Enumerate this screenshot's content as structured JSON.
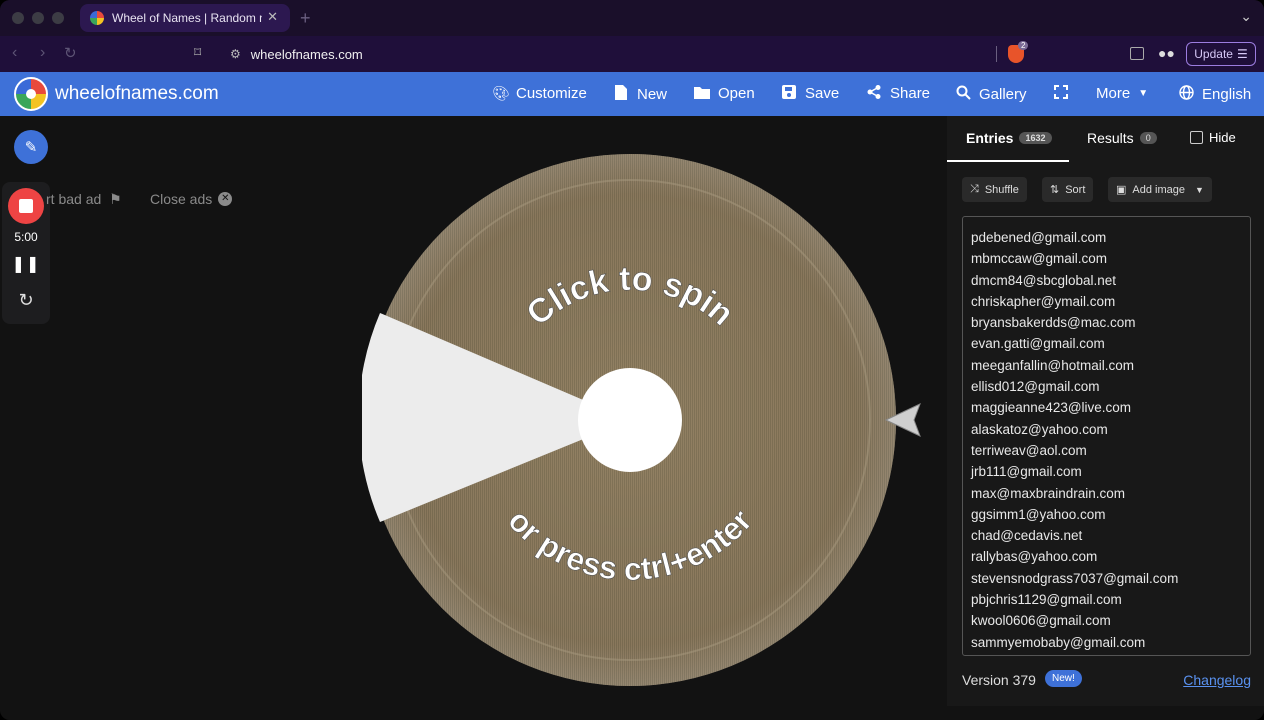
{
  "browser": {
    "tab_title": "Wheel of Names | Random na",
    "url": "wheelofnames.com",
    "shields_count": "2",
    "update_label": "Update"
  },
  "app": {
    "brand": "wheelofnames.com",
    "menu": {
      "customize": "Customize",
      "new": "New",
      "open": "Open",
      "save": "Save",
      "share": "Share",
      "gallery": "Gallery",
      "more": "More",
      "language": "English"
    }
  },
  "recorder": {
    "time": "5:00"
  },
  "ads": {
    "report": "rt bad ad",
    "close": "Close ads"
  },
  "wheel": {
    "top_text": "Click to spin",
    "bottom_text": "or press ctrl+enter"
  },
  "panel": {
    "tab_entries": "Entries",
    "entries_count": "1632",
    "tab_results": "Results",
    "results_count": "0",
    "hide_label": "Hide",
    "shuffle_label": "Shuffle",
    "sort_label": "Sort",
    "add_image_label": "Add image",
    "entries": [
      "pdebened@gmail.com",
      "mbmccaw@gmail.com",
      "dmcm84@sbcglobal.net",
      "chriskapher@ymail.com",
      "bryansbakerdds@mac.com",
      "evan.gatti@gmail.com",
      "meeganfallin@hotmail.com",
      "ellisd012@gmail.com",
      "maggieanne423@live.com",
      "alaskatoz@yahoo.com",
      "terriweav@aol.com",
      "jrb111@gmail.com",
      "max@maxbraindrain.com",
      "ggsimm1@yahoo.com",
      "chad@cedavis.net",
      "rallybas@yahoo.com",
      "stevensnodgrass7037@gmail.com",
      "pbjchris1129@gmail.com",
      "kwool0606@gmail.com",
      "sammyemobaby@gmail.com"
    ],
    "version": "Version 379",
    "new_badge": "New!",
    "changelog": "Changelog"
  },
  "colors": {
    "brand_blue": "#3e71d8",
    "record_red": "#ee4444",
    "wheel_bronze": "#8d7a5e"
  }
}
